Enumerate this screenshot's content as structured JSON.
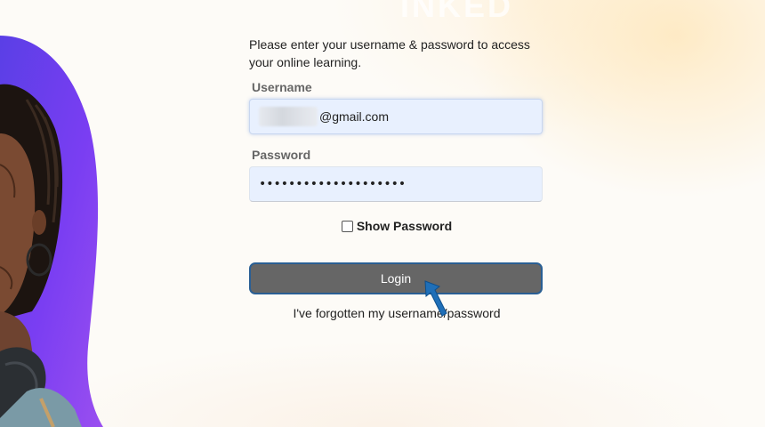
{
  "watermark": "INKED",
  "form": {
    "intro": "Please enter your username & password to access your online learning.",
    "username_label": "Username",
    "username_value": "@gmail.com",
    "password_label": "Password",
    "password_value": "••••••••••••••••••••",
    "show_password_label": "Show Password",
    "show_password_checked": false,
    "login_label": "Login",
    "forgot_link": "I've forgotten my username/password"
  },
  "colors": {
    "hero_purple": "#6a3cf0",
    "input_bg": "#e8f0fe",
    "button_bg": "#666666",
    "button_border": "#2a5f94",
    "arrow": "#1f6fb8"
  },
  "icons": {
    "pointer": "annotation-arrow-icon"
  }
}
